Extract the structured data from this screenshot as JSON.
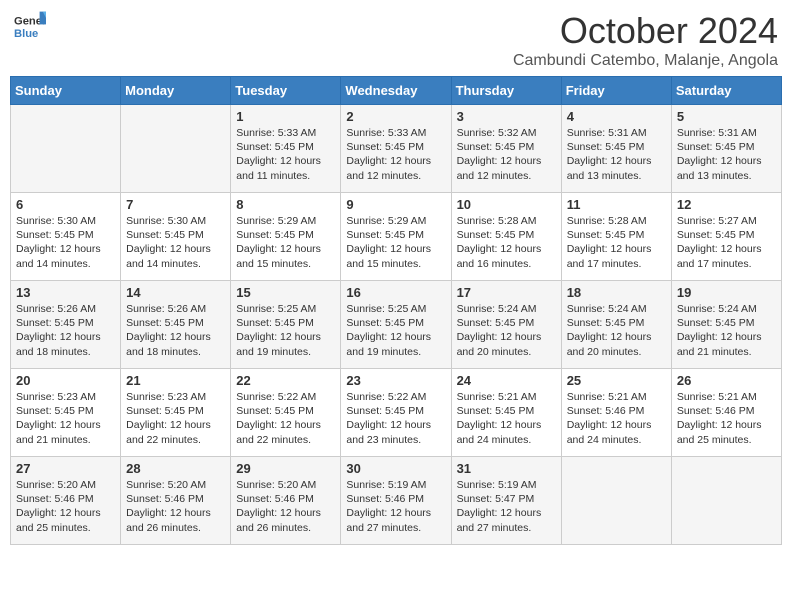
{
  "header": {
    "logo_general": "General",
    "logo_blue": "Blue",
    "month_title": "October 2024",
    "location": "Cambundi Catembo, Malanje, Angola"
  },
  "weekdays": [
    "Sunday",
    "Monday",
    "Tuesday",
    "Wednesday",
    "Thursday",
    "Friday",
    "Saturday"
  ],
  "weeks": [
    [
      {
        "day": "",
        "sunrise": "",
        "sunset": "",
        "daylight": ""
      },
      {
        "day": "",
        "sunrise": "",
        "sunset": "",
        "daylight": ""
      },
      {
        "day": "1",
        "sunrise": "Sunrise: 5:33 AM",
        "sunset": "Sunset: 5:45 PM",
        "daylight": "Daylight: 12 hours and 11 minutes."
      },
      {
        "day": "2",
        "sunrise": "Sunrise: 5:33 AM",
        "sunset": "Sunset: 5:45 PM",
        "daylight": "Daylight: 12 hours and 12 minutes."
      },
      {
        "day": "3",
        "sunrise": "Sunrise: 5:32 AM",
        "sunset": "Sunset: 5:45 PM",
        "daylight": "Daylight: 12 hours and 12 minutes."
      },
      {
        "day": "4",
        "sunrise": "Sunrise: 5:31 AM",
        "sunset": "Sunset: 5:45 PM",
        "daylight": "Daylight: 12 hours and 13 minutes."
      },
      {
        "day": "5",
        "sunrise": "Sunrise: 5:31 AM",
        "sunset": "Sunset: 5:45 PM",
        "daylight": "Daylight: 12 hours and 13 minutes."
      }
    ],
    [
      {
        "day": "6",
        "sunrise": "Sunrise: 5:30 AM",
        "sunset": "Sunset: 5:45 PM",
        "daylight": "Daylight: 12 hours and 14 minutes."
      },
      {
        "day": "7",
        "sunrise": "Sunrise: 5:30 AM",
        "sunset": "Sunset: 5:45 PM",
        "daylight": "Daylight: 12 hours and 14 minutes."
      },
      {
        "day": "8",
        "sunrise": "Sunrise: 5:29 AM",
        "sunset": "Sunset: 5:45 PM",
        "daylight": "Daylight: 12 hours and 15 minutes."
      },
      {
        "day": "9",
        "sunrise": "Sunrise: 5:29 AM",
        "sunset": "Sunset: 5:45 PM",
        "daylight": "Daylight: 12 hours and 15 minutes."
      },
      {
        "day": "10",
        "sunrise": "Sunrise: 5:28 AM",
        "sunset": "Sunset: 5:45 PM",
        "daylight": "Daylight: 12 hours and 16 minutes."
      },
      {
        "day": "11",
        "sunrise": "Sunrise: 5:28 AM",
        "sunset": "Sunset: 5:45 PM",
        "daylight": "Daylight: 12 hours and 17 minutes."
      },
      {
        "day": "12",
        "sunrise": "Sunrise: 5:27 AM",
        "sunset": "Sunset: 5:45 PM",
        "daylight": "Daylight: 12 hours and 17 minutes."
      }
    ],
    [
      {
        "day": "13",
        "sunrise": "Sunrise: 5:26 AM",
        "sunset": "Sunset: 5:45 PM",
        "daylight": "Daylight: 12 hours and 18 minutes."
      },
      {
        "day": "14",
        "sunrise": "Sunrise: 5:26 AM",
        "sunset": "Sunset: 5:45 PM",
        "daylight": "Daylight: 12 hours and 18 minutes."
      },
      {
        "day": "15",
        "sunrise": "Sunrise: 5:25 AM",
        "sunset": "Sunset: 5:45 PM",
        "daylight": "Daylight: 12 hours and 19 minutes."
      },
      {
        "day": "16",
        "sunrise": "Sunrise: 5:25 AM",
        "sunset": "Sunset: 5:45 PM",
        "daylight": "Daylight: 12 hours and 19 minutes."
      },
      {
        "day": "17",
        "sunrise": "Sunrise: 5:24 AM",
        "sunset": "Sunset: 5:45 PM",
        "daylight": "Daylight: 12 hours and 20 minutes."
      },
      {
        "day": "18",
        "sunrise": "Sunrise: 5:24 AM",
        "sunset": "Sunset: 5:45 PM",
        "daylight": "Daylight: 12 hours and 20 minutes."
      },
      {
        "day": "19",
        "sunrise": "Sunrise: 5:24 AM",
        "sunset": "Sunset: 5:45 PM",
        "daylight": "Daylight: 12 hours and 21 minutes."
      }
    ],
    [
      {
        "day": "20",
        "sunrise": "Sunrise: 5:23 AM",
        "sunset": "Sunset: 5:45 PM",
        "daylight": "Daylight: 12 hours and 21 minutes."
      },
      {
        "day": "21",
        "sunrise": "Sunrise: 5:23 AM",
        "sunset": "Sunset: 5:45 PM",
        "daylight": "Daylight: 12 hours and 22 minutes."
      },
      {
        "day": "22",
        "sunrise": "Sunrise: 5:22 AM",
        "sunset": "Sunset: 5:45 PM",
        "daylight": "Daylight: 12 hours and 22 minutes."
      },
      {
        "day": "23",
        "sunrise": "Sunrise: 5:22 AM",
        "sunset": "Sunset: 5:45 PM",
        "daylight": "Daylight: 12 hours and 23 minutes."
      },
      {
        "day": "24",
        "sunrise": "Sunrise: 5:21 AM",
        "sunset": "Sunset: 5:45 PM",
        "daylight": "Daylight: 12 hours and 24 minutes."
      },
      {
        "day": "25",
        "sunrise": "Sunrise: 5:21 AM",
        "sunset": "Sunset: 5:46 PM",
        "daylight": "Daylight: 12 hours and 24 minutes."
      },
      {
        "day": "26",
        "sunrise": "Sunrise: 5:21 AM",
        "sunset": "Sunset: 5:46 PM",
        "daylight": "Daylight: 12 hours and 25 minutes."
      }
    ],
    [
      {
        "day": "27",
        "sunrise": "Sunrise: 5:20 AM",
        "sunset": "Sunset: 5:46 PM",
        "daylight": "Daylight: 12 hours and 25 minutes."
      },
      {
        "day": "28",
        "sunrise": "Sunrise: 5:20 AM",
        "sunset": "Sunset: 5:46 PM",
        "daylight": "Daylight: 12 hours and 26 minutes."
      },
      {
        "day": "29",
        "sunrise": "Sunrise: 5:20 AM",
        "sunset": "Sunset: 5:46 PM",
        "daylight": "Daylight: 12 hours and 26 minutes."
      },
      {
        "day": "30",
        "sunrise": "Sunrise: 5:19 AM",
        "sunset": "Sunset: 5:46 PM",
        "daylight": "Daylight: 12 hours and 27 minutes."
      },
      {
        "day": "31",
        "sunrise": "Sunrise: 5:19 AM",
        "sunset": "Sunset: 5:47 PM",
        "daylight": "Daylight: 12 hours and 27 minutes."
      },
      {
        "day": "",
        "sunrise": "",
        "sunset": "",
        "daylight": ""
      },
      {
        "day": "",
        "sunrise": "",
        "sunset": "",
        "daylight": ""
      }
    ]
  ]
}
